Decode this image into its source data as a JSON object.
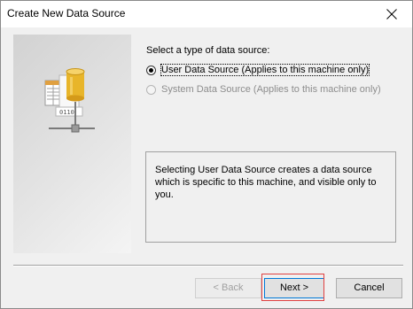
{
  "window": {
    "title": "Create New Data Source",
    "close_icon": "close-icon"
  },
  "prompt": {
    "label": "Select a type of data source:"
  },
  "options": [
    {
      "label": "User Data Source (Applies to this machine only)",
      "checked": true,
      "enabled": true
    },
    {
      "label": "System Data Source (Applies to this machine only)",
      "checked": false,
      "enabled": false
    }
  ],
  "description": {
    "text": "Selecting User Data Source creates a data source which is specific to this machine, and visible only to you."
  },
  "buttons": {
    "back_label": "< Back",
    "next_label": "Next >",
    "cancel_label": "Cancel"
  },
  "illustration": {
    "icon": "database-network-icon",
    "binary_text": "0110"
  },
  "colors": {
    "highlight_border": "#e04040",
    "disabled_text": "#8d8d8d",
    "database_gold": "#e8b52a"
  }
}
